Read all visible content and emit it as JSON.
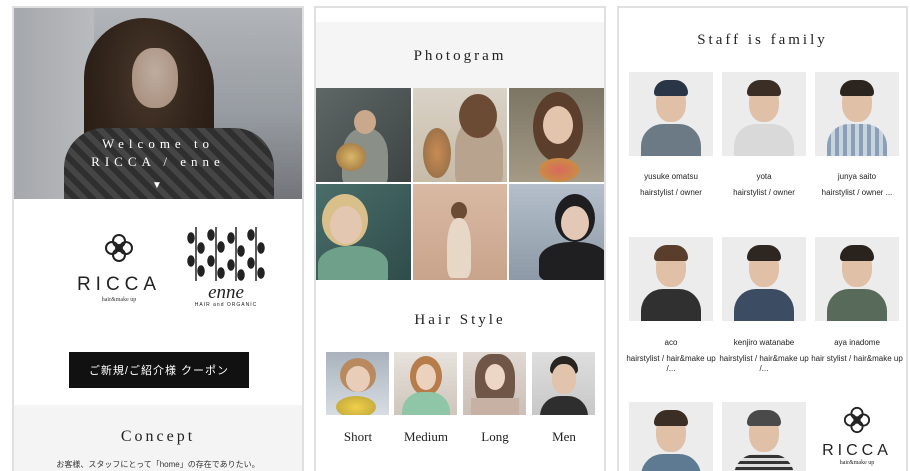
{
  "panel1": {
    "hero_line1": "Welcome to",
    "hero_line2": "RICCA / enne",
    "ricca_logo_name": "RICCA",
    "ricca_logo_sub": "hair&make up",
    "enne_logo_script": "enne",
    "enne_logo_sub": "HAIR and ORGANIC",
    "coupon_button": "ご新規/ご紹介様 クーポン",
    "concept_title": "Concept",
    "concept_text": "お客様、スタッフにとって「home」の存在でありたい。"
  },
  "panel2": {
    "photogram_title": "Photogram",
    "hairstyle_title": "Hair Style",
    "styles": [
      {
        "label": "Short"
      },
      {
        "label": "Medium"
      },
      {
        "label": "Long"
      },
      {
        "label": "Men"
      }
    ]
  },
  "panel3": {
    "title": "Staff is family",
    "staff": [
      {
        "name": "yusuke omatsu",
        "role": "hairstylist / owner"
      },
      {
        "name": "yota",
        "role": "hairstylist / owner"
      },
      {
        "name": "junya saito",
        "role": "hairstylist / owner ..."
      },
      {
        "name": "aco",
        "role": "hairstylist / hair&make up /..."
      },
      {
        "name": "kenjiro watanabe",
        "role": "hairstylist / hair&make up /..."
      },
      {
        "name": "aya inadome",
        "role": "hair stylist / hair&make up"
      }
    ],
    "logo_name": "RICCA",
    "logo_sub": "hair&make up"
  },
  "colors": {
    "button_bg": "#111111",
    "section_bg": "#f4f4f4"
  }
}
